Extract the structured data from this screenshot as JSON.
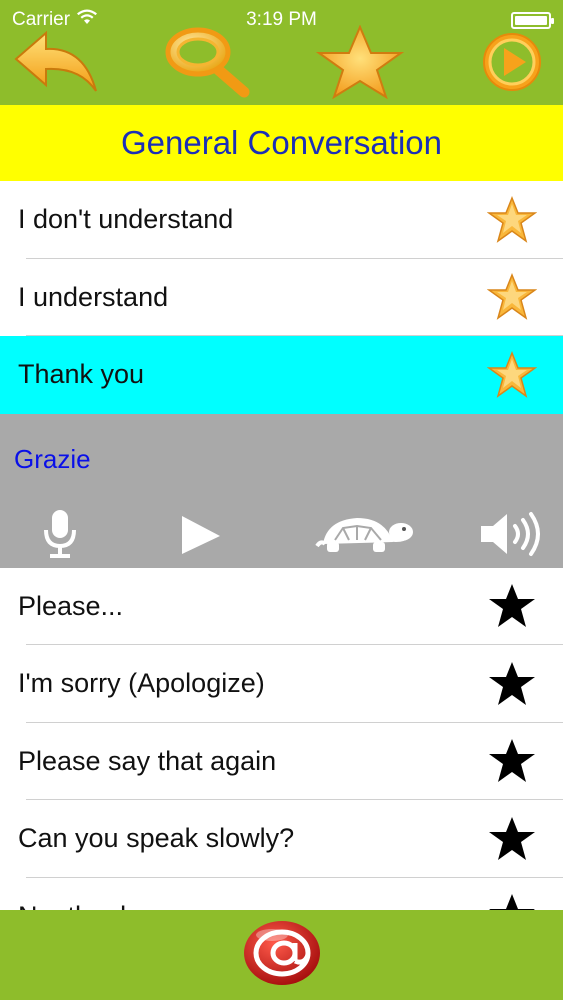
{
  "status": {
    "carrier": "Carrier",
    "time": "3:19 PM"
  },
  "toolbar": {
    "icons": [
      "back-arrow-icon",
      "search-icon",
      "favorites-star-icon",
      "play-icon"
    ]
  },
  "header": {
    "title": "General Conversation"
  },
  "phrases_before": [
    {
      "label": "I don't understand",
      "favorite": true
    },
    {
      "label": "I understand",
      "favorite": true
    },
    {
      "label": "Thank you",
      "favorite": true,
      "selected": true
    }
  ],
  "player": {
    "translation": "Grazie",
    "controls": [
      "microphone-icon",
      "play-icon",
      "turtle-slow-icon",
      "speaker-icon"
    ]
  },
  "phrases_after": [
    {
      "label": "Please...",
      "favorite": false
    },
    {
      "label": "I'm sorry (Apologize)",
      "favorite": false
    },
    {
      "label": "Please say that again",
      "favorite": false
    },
    {
      "label": "Can you speak slowly?",
      "favorite": false
    },
    {
      "label": "No, thank you",
      "favorite": false
    }
  ],
  "bottom": {
    "icon": "email-at-icon"
  },
  "colors": {
    "bar_green": "#8ebd2b",
    "title_yellow": "#ffff00",
    "title_text": "#1b2fb7",
    "selected_row": "#00ffff",
    "player_gray": "#a9a9a9",
    "translation_blue": "#0a10e8",
    "icon_orange": "#f7a21b"
  }
}
